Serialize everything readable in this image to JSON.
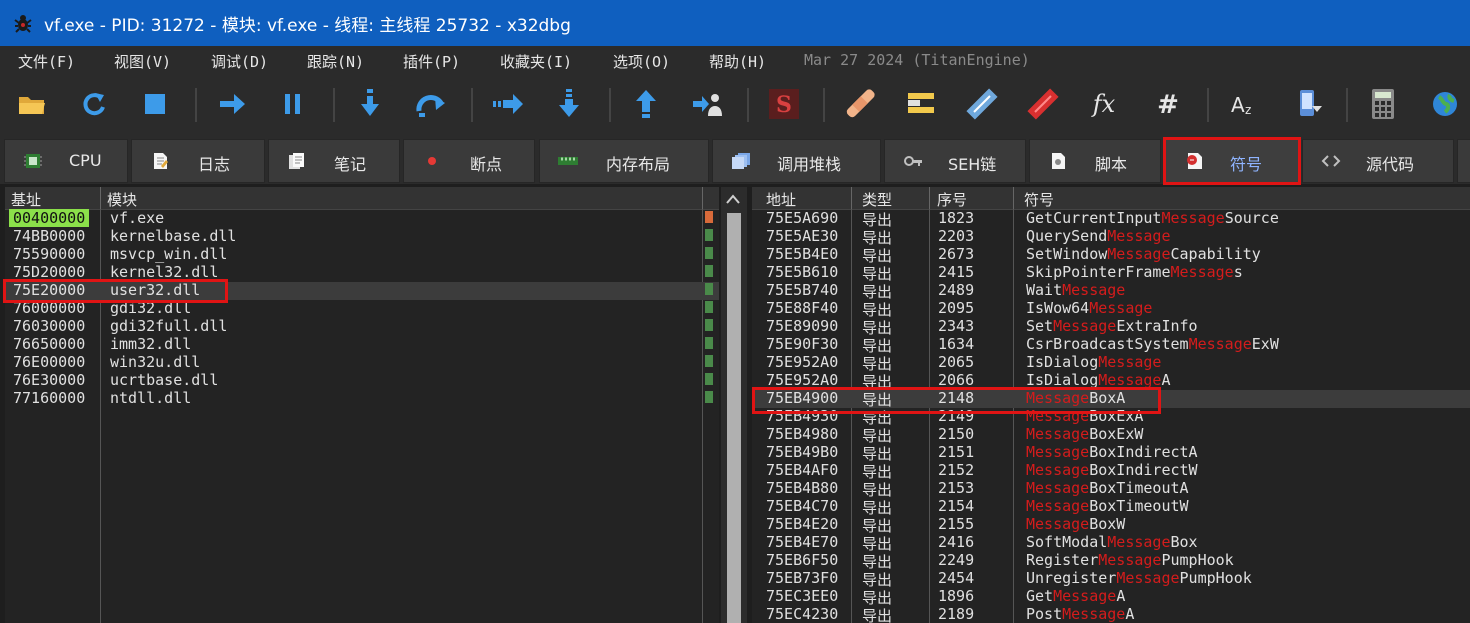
{
  "window": {
    "title": "vf.exe - PID: 31272 - 模块: vf.exe - 线程: 主线程 25732 - x32dbg"
  },
  "menu": {
    "items": [
      "文件(F)",
      "视图(V)",
      "调试(D)",
      "跟踪(N)",
      "插件(P)",
      "收藏夹(I)",
      "选项(O)",
      "帮助(H)"
    ],
    "build_info": "Mar 27 2024 (TitanEngine)"
  },
  "toolbar": {
    "buttons": [
      "open-icon",
      "restart-icon",
      "stop-icon",
      "run-icon",
      "pause-icon",
      "step-into-icon",
      "step-over-icon",
      "trace-into-icon",
      "trace-over-icon",
      "execute-till-return-icon",
      "run-to-user-code-icon",
      "script-icon",
      "patch-icon",
      "comment-icon",
      "label-icon",
      "bookmark-icon",
      "function-icon",
      "hash-icon",
      "font-icon",
      "device-icon",
      "calculator-icon",
      "globe-icon"
    ]
  },
  "tabs": [
    {
      "label": "CPU"
    },
    {
      "label": "日志"
    },
    {
      "label": "笔记"
    },
    {
      "label": "断点"
    },
    {
      "label": "内存布局"
    },
    {
      "label": "调用堆栈"
    },
    {
      "label": "SEH链"
    },
    {
      "label": "脚本"
    },
    {
      "label": "符号"
    },
    {
      "label": "源代码"
    }
  ],
  "modules": {
    "headers": {
      "base": "基址",
      "module": "模块"
    },
    "rows": [
      {
        "base": "00400000",
        "name": "vf.exe"
      },
      {
        "base": "74BB0000",
        "name": "kernelbase.dll"
      },
      {
        "base": "75590000",
        "name": "msvcp_win.dll"
      },
      {
        "base": "75D20000",
        "name": "kernel32.dll"
      },
      {
        "base": "75E20000",
        "name": "user32.dll"
      },
      {
        "base": "76000000",
        "name": "gdi32.dll"
      },
      {
        "base": "76030000",
        "name": "gdi32full.dll"
      },
      {
        "base": "76650000",
        "name": "imm32.dll"
      },
      {
        "base": "76E00000",
        "name": "win32u.dll"
      },
      {
        "base": "76E30000",
        "name": "ucrtbase.dll"
      },
      {
        "base": "77160000",
        "name": "ntdll.dll"
      }
    ]
  },
  "symbols": {
    "headers": {
      "address": "地址",
      "type": "类型",
      "ordinal": "序号",
      "symbol": "符号"
    },
    "rows": [
      {
        "addr": "75E5A690",
        "type": "导出",
        "ord": "1823",
        "pre": "GetCurrentInput",
        "mid": "Message",
        "post": "Source"
      },
      {
        "addr": "75E5AE30",
        "type": "导出",
        "ord": "2203",
        "pre": "QuerySend",
        "mid": "Message",
        "post": ""
      },
      {
        "addr": "75E5B4E0",
        "type": "导出",
        "ord": "2673",
        "pre": "SetWindow",
        "mid": "Message",
        "post": "Capability"
      },
      {
        "addr": "75E5B610",
        "type": "导出",
        "ord": "2415",
        "pre": "SkipPointerFrame",
        "mid": "Message",
        "post": "s"
      },
      {
        "addr": "75E5B740",
        "type": "导出",
        "ord": "2489",
        "pre": "Wait",
        "mid": "Message",
        "post": ""
      },
      {
        "addr": "75E88F40",
        "type": "导出",
        "ord": "2095",
        "pre": "IsWow64",
        "mid": "Message",
        "post": ""
      },
      {
        "addr": "75E89090",
        "type": "导出",
        "ord": "2343",
        "pre": "Set",
        "mid": "Message",
        "post": "ExtraInfo"
      },
      {
        "addr": "75E90F30",
        "type": "导出",
        "ord": "1634",
        "pre": "CsrBroadcastSystem",
        "mid": "Message",
        "post": "ExW"
      },
      {
        "addr": "75E952A0",
        "type": "导出",
        "ord": "2065",
        "pre": "IsDialog",
        "mid": "Message",
        "post": ""
      },
      {
        "addr": "75E952A0",
        "type": "导出",
        "ord": "2066",
        "pre": "IsDialog",
        "mid": "Message",
        "post": "A"
      },
      {
        "addr": "75EB4900",
        "type": "导出",
        "ord": "2148",
        "pre": "",
        "mid": "Message",
        "post": "BoxA"
      },
      {
        "addr": "75EB4930",
        "type": "导出",
        "ord": "2149",
        "pre": "",
        "mid": "Message",
        "post": "BoxExA"
      },
      {
        "addr": "75EB4980",
        "type": "导出",
        "ord": "2150",
        "pre": "",
        "mid": "Message",
        "post": "BoxExW"
      },
      {
        "addr": "75EB49B0",
        "type": "导出",
        "ord": "2151",
        "pre": "",
        "mid": "Message",
        "post": "BoxIndirectA"
      },
      {
        "addr": "75EB4AF0",
        "type": "导出",
        "ord": "2152",
        "pre": "",
        "mid": "Message",
        "post": "BoxIndirectW"
      },
      {
        "addr": "75EB4B80",
        "type": "导出",
        "ord": "2153",
        "pre": "",
        "mid": "Message",
        "post": "BoxTimeoutA"
      },
      {
        "addr": "75EB4C70",
        "type": "导出",
        "ord": "2154",
        "pre": "",
        "mid": "Message",
        "post": "BoxTimeoutW"
      },
      {
        "addr": "75EB4E20",
        "type": "导出",
        "ord": "2155",
        "pre": "",
        "mid": "Message",
        "post": "BoxW"
      },
      {
        "addr": "75EB4E70",
        "type": "导出",
        "ord": "2416",
        "pre": "SoftModal",
        "mid": "Message",
        "post": "Box"
      },
      {
        "addr": "75EB6F50",
        "type": "导出",
        "ord": "2249",
        "pre": "Register",
        "mid": "Message",
        "post": "PumpHook"
      },
      {
        "addr": "75EB73F0",
        "type": "导出",
        "ord": "2454",
        "pre": "Unregister",
        "mid": "Message",
        "post": "PumpHook"
      },
      {
        "addr": "75EC3EE0",
        "type": "导出",
        "ord": "1896",
        "pre": "Get",
        "mid": "Message",
        "post": "A"
      },
      {
        "addr": "75EC4230",
        "type": "导出",
        "ord": "2189",
        "pre": "Post",
        "mid": "Message",
        "post": "A"
      }
    ]
  },
  "colors": {
    "accent": "#0f5fbf",
    "highlight": "#e01414",
    "search_match": "#d41c1c",
    "entry_point": "#8be04a"
  }
}
